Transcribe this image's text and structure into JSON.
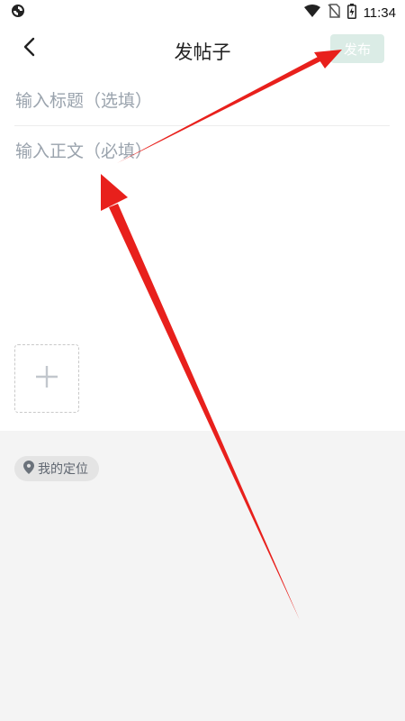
{
  "status_bar": {
    "time": "11:34",
    "icons": [
      "sync-icon",
      "wifi-icon",
      "no-sim-icon",
      "battery-icon"
    ]
  },
  "header": {
    "back_icon": "chevron-left-icon",
    "title": "发帖子",
    "publish_label": "发布"
  },
  "form": {
    "title_placeholder": "输入标题（选填）",
    "body_placeholder": "输入正文（必填）",
    "add_image_icon": "plus-icon"
  },
  "location": {
    "icon": "location-pin-icon",
    "label": "我的定位"
  },
  "colors": {
    "publish_disabled_bg": "#dbece6",
    "placeholder": "#9aa3ad",
    "bottom_panel": "#f4f4f4",
    "annotation_arrow": "#e8201c"
  }
}
